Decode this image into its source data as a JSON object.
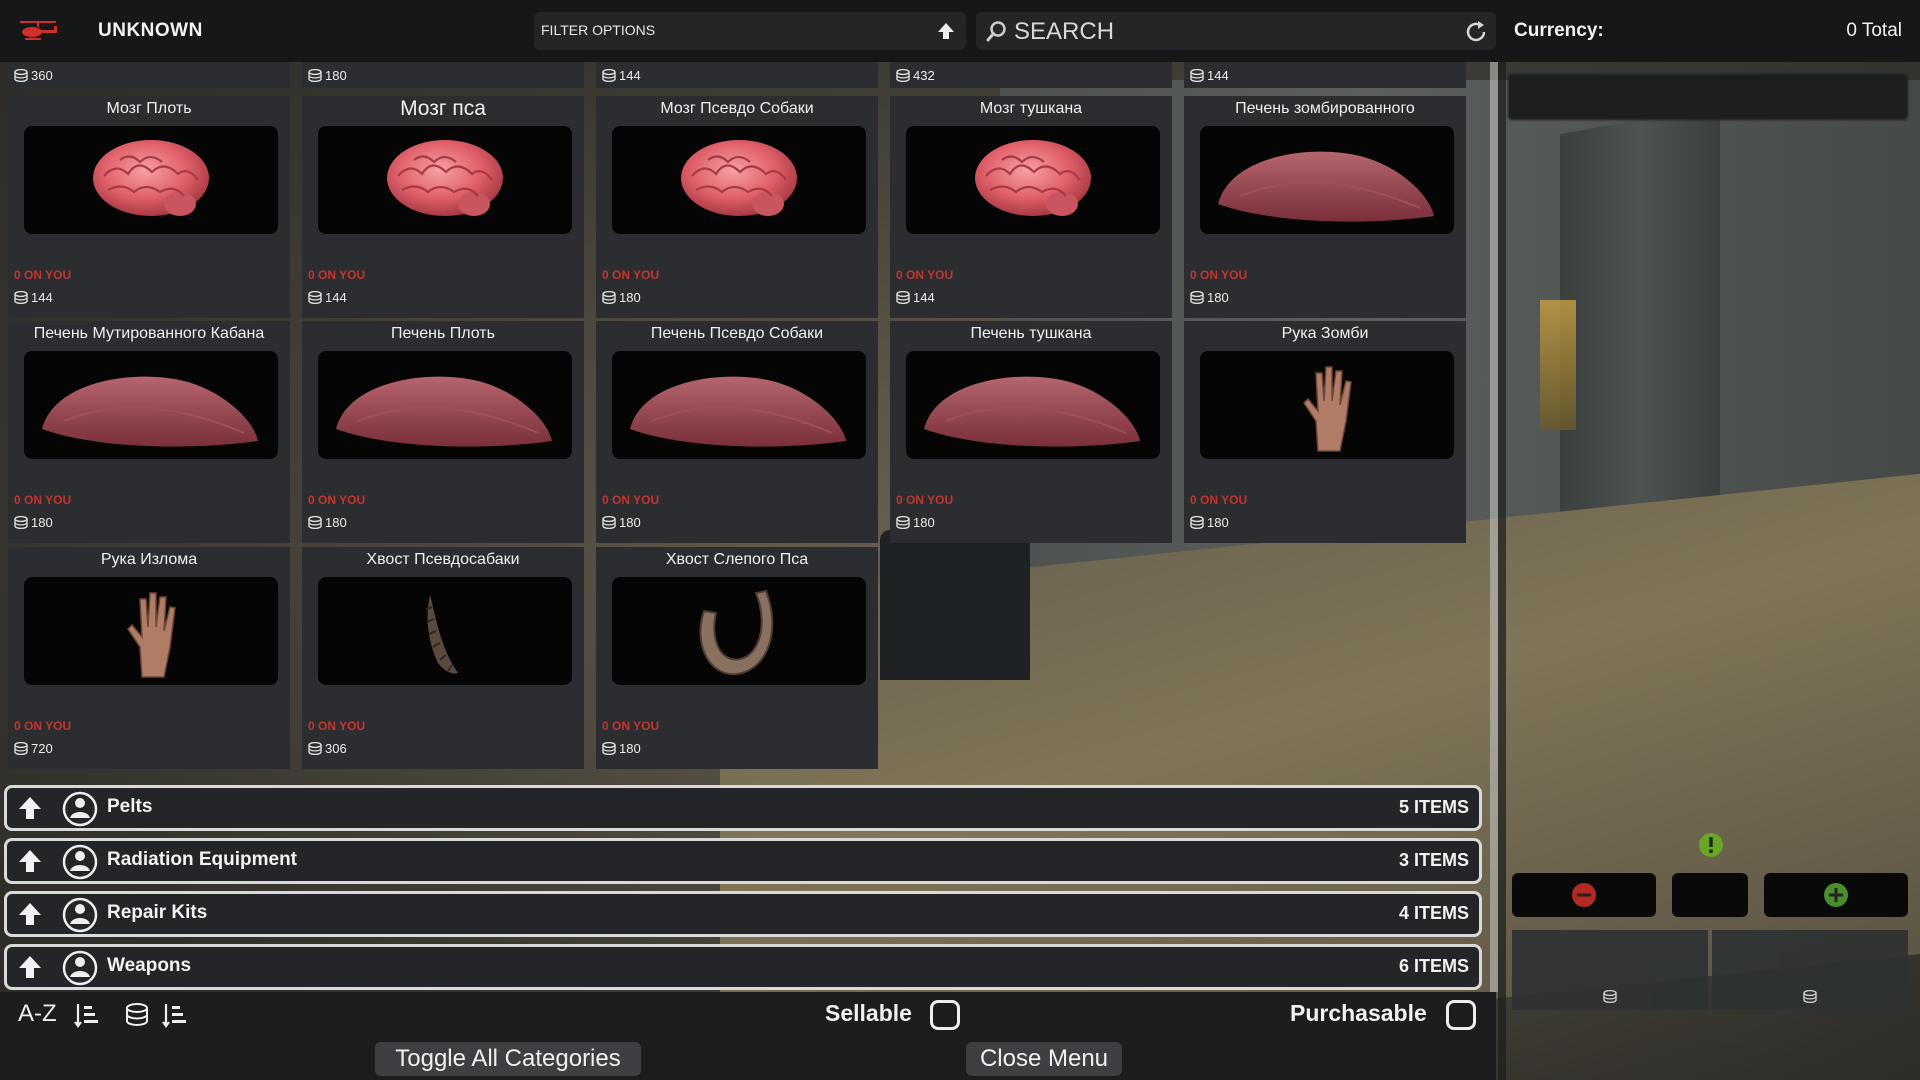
{
  "header": {
    "faction": "UNKNOWN",
    "filter_label": "FILTER OPTIONS",
    "search_placeholder": "SEARCH"
  },
  "currency": {
    "label": "Currency:",
    "total": "0 Total"
  },
  "prev_row_prices": [
    "360",
    "180",
    "144",
    "432",
    "144"
  ],
  "items": [
    {
      "name": "Мозг Плоть",
      "on_you": "0 ON YOU",
      "price": "144",
      "icon": "brain"
    },
    {
      "name": "Мозг пса",
      "on_you": "0 ON YOU",
      "price": "144",
      "icon": "brain"
    },
    {
      "name": "Мозг Псевдо Собаки",
      "on_you": "0 ON YOU",
      "price": "180",
      "icon": "brain"
    },
    {
      "name": "Мозг тушкана",
      "on_you": "0 ON YOU",
      "price": "144",
      "icon": "brain"
    },
    {
      "name": "Печень зомбированного",
      "on_you": "0 ON YOU",
      "price": "180",
      "icon": "liver"
    },
    {
      "name": "Печень Мутированного Кабана",
      "on_you": "0 ON YOU",
      "price": "180",
      "icon": "liver"
    },
    {
      "name": "Печень Плоть",
      "on_you": "0 ON YOU",
      "price": "180",
      "icon": "liver"
    },
    {
      "name": "Печень Псевдо Собаки",
      "on_you": "0 ON YOU",
      "price": "180",
      "icon": "liver"
    },
    {
      "name": "Печень тушкана",
      "on_you": "0 ON YOU",
      "price": "180",
      "icon": "liver"
    },
    {
      "name": "Рука Зомби",
      "on_you": "0 ON YOU",
      "price": "180",
      "icon": "hand"
    },
    {
      "name": "Рука Излома",
      "on_you": "0 ON YOU",
      "price": "720",
      "icon": "hand"
    },
    {
      "name": "Хвост Псевдосабаки",
      "on_you": "0 ON YOU",
      "price": "306",
      "icon": "tail"
    },
    {
      "name": "Хвост Слепого Пса",
      "on_you": "0 ON YOU",
      "price": "180",
      "icon": "horn-tail"
    }
  ],
  "categories": [
    {
      "name": "Pelts",
      "count": "5 ITEMS"
    },
    {
      "name": "Radiation Equipment",
      "count": "3 ITEMS"
    },
    {
      "name": "Repair Kits",
      "count": "4 ITEMS"
    },
    {
      "name": "Weapons",
      "count": "6 ITEMS"
    }
  ],
  "footer": {
    "sort_label": "A-Z",
    "sellable_label": "Sellable",
    "purchasable_label": "Purchasable",
    "toggle_all_label": "Toggle All Categories",
    "close_menu_label": "Close Menu"
  },
  "colors": {
    "accent_red": "#c5352f",
    "panel": "#2b2d30",
    "topbar": "#151719"
  }
}
